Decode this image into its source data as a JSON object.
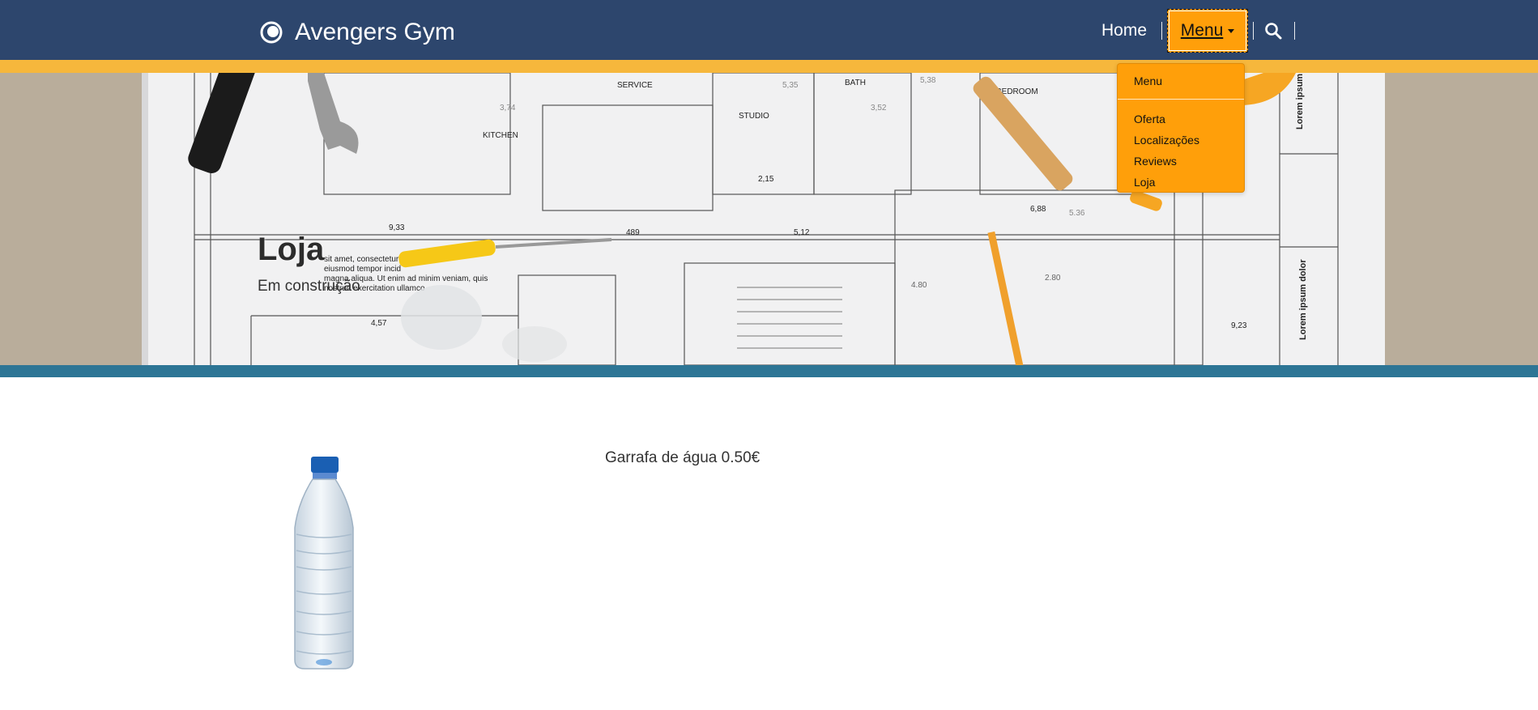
{
  "brand": {
    "name": "Avengers Gym",
    "logo_icon": "ring-logo-icon"
  },
  "nav": {
    "home_label": "Home",
    "menu_label": "Menu",
    "search_icon": "search-icon"
  },
  "dropdown": {
    "header": "Menu",
    "items": [
      {
        "label": "Oferta"
      },
      {
        "label": "Localizações"
      },
      {
        "label": "Reviews"
      },
      {
        "label": "Loja"
      }
    ]
  },
  "hero": {
    "title": "Loja",
    "subtitle": "Em construção",
    "blueprint_labels": [
      "SERVICE",
      "BATH",
      "BEDROOM",
      "KITCHEN",
      "STUDIO",
      "2,15",
      "9,33",
      "489",
      "5,12",
      "6,88",
      "5.36",
      "4,57",
      "9,23",
      "2.80",
      "4.80",
      "3,74",
      "5,35",
      "5,38",
      "3,52",
      "Lorem ipsum",
      "Lorem ipsum dolor"
    ],
    "blueprint_text": [
      "sit amet, consectetur",
      "eiusmod tempor incid",
      "magna aliqua. Ut enim ad minim veniam, quis",
      "nostrud exercitation ullamco"
    ]
  },
  "product": {
    "text": "Garrafa de água 0.50€",
    "image_icon": "water-bottle-image"
  },
  "colors": {
    "navbar": "#2d466d",
    "stripe": "#f6b73c",
    "accent_orange": "#ff9f0a",
    "teal_bar": "#2d7595"
  }
}
